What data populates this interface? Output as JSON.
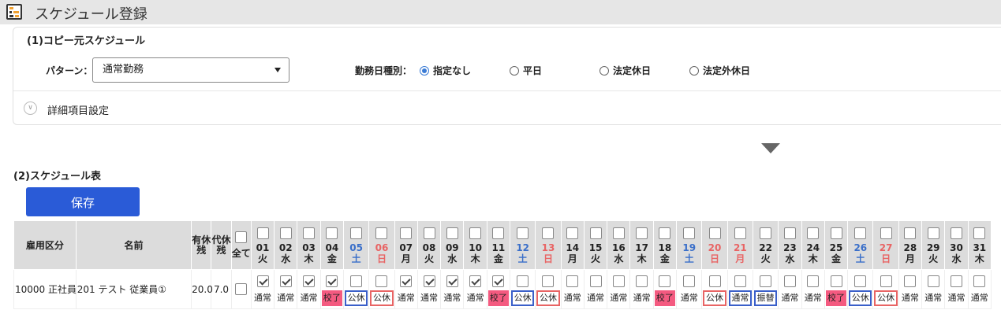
{
  "app": {
    "title": "スケジュール登録",
    "icon": "schedule-list-icon"
  },
  "copy_source": {
    "section_title": "(1)コピー元スケジュール",
    "pattern_label": "パターン：",
    "pattern_value": "通常勤務",
    "workday_label": "勤務日種別：",
    "radios": [
      {
        "label": "指定なし",
        "checked": true
      },
      {
        "label": "平日",
        "checked": false
      },
      {
        "label": "法定休日",
        "checked": false
      },
      {
        "label": "法定外休日",
        "checked": false
      }
    ],
    "detail_label": "詳細項目設定"
  },
  "schedule": {
    "section_title": "(2)スケジュール表",
    "save_label": "保存",
    "headers": {
      "employment": "雇用区分",
      "name": "名前",
      "paid_leave": "有休残",
      "comp_leave": "代休残",
      "all": "全て"
    },
    "days": [
      {
        "num": "01",
        "wd": "火",
        "color": "normal"
      },
      {
        "num": "02",
        "wd": "水",
        "color": "normal"
      },
      {
        "num": "03",
        "wd": "木",
        "color": "normal"
      },
      {
        "num": "04",
        "wd": "金",
        "color": "normal"
      },
      {
        "num": "05",
        "wd": "土",
        "color": "blue"
      },
      {
        "num": "06",
        "wd": "日",
        "color": "red"
      },
      {
        "num": "07",
        "wd": "月",
        "color": "normal"
      },
      {
        "num": "08",
        "wd": "火",
        "color": "normal"
      },
      {
        "num": "09",
        "wd": "水",
        "color": "normal"
      },
      {
        "num": "10",
        "wd": "木",
        "color": "normal"
      },
      {
        "num": "11",
        "wd": "金",
        "color": "normal"
      },
      {
        "num": "12",
        "wd": "土",
        "color": "blue"
      },
      {
        "num": "13",
        "wd": "日",
        "color": "red"
      },
      {
        "num": "14",
        "wd": "月",
        "color": "normal"
      },
      {
        "num": "15",
        "wd": "火",
        "color": "normal"
      },
      {
        "num": "16",
        "wd": "水",
        "color": "normal"
      },
      {
        "num": "17",
        "wd": "木",
        "color": "normal"
      },
      {
        "num": "18",
        "wd": "金",
        "color": "normal"
      },
      {
        "num": "19",
        "wd": "土",
        "color": "blue"
      },
      {
        "num": "20",
        "wd": "日",
        "color": "red"
      },
      {
        "num": "21",
        "wd": "月",
        "color": "red"
      },
      {
        "num": "22",
        "wd": "火",
        "color": "normal"
      },
      {
        "num": "23",
        "wd": "水",
        "color": "normal"
      },
      {
        "num": "24",
        "wd": "木",
        "color": "normal"
      },
      {
        "num": "25",
        "wd": "金",
        "color": "normal"
      },
      {
        "num": "26",
        "wd": "土",
        "color": "blue"
      },
      {
        "num": "27",
        "wd": "日",
        "color": "red"
      },
      {
        "num": "28",
        "wd": "月",
        "color": "normal"
      },
      {
        "num": "29",
        "wd": "火",
        "color": "normal"
      },
      {
        "num": "30",
        "wd": "水",
        "color": "normal"
      },
      {
        "num": "31",
        "wd": "木",
        "color": "normal"
      }
    ],
    "rows": [
      {
        "employment": "10000 正社員",
        "name": "201 テスト 従業員①",
        "paid_leave": "20.0",
        "comp_leave": "7.0",
        "cells": [
          {
            "checked": true,
            "text": "通常",
            "style": "plain"
          },
          {
            "checked": true,
            "text": "通常",
            "style": "plain"
          },
          {
            "checked": true,
            "text": "通常",
            "style": "plain"
          },
          {
            "checked": true,
            "text": "校了",
            "style": "pink"
          },
          {
            "checked": false,
            "text": "公休",
            "style": "bluebox"
          },
          {
            "checked": false,
            "text": "公休",
            "style": "redbox"
          },
          {
            "checked": true,
            "text": "通常",
            "style": "plain"
          },
          {
            "checked": true,
            "text": "通常",
            "style": "plain"
          },
          {
            "checked": true,
            "text": "通常",
            "style": "plain"
          },
          {
            "checked": true,
            "text": "通常",
            "style": "plain"
          },
          {
            "checked": true,
            "text": "校了",
            "style": "pink"
          },
          {
            "checked": false,
            "text": "公休",
            "style": "bluebox"
          },
          {
            "checked": false,
            "text": "公休",
            "style": "redbox"
          },
          {
            "checked": false,
            "text": "通常",
            "style": "plain"
          },
          {
            "checked": false,
            "text": "通常",
            "style": "plain"
          },
          {
            "checked": false,
            "text": "通常",
            "style": "plain"
          },
          {
            "checked": false,
            "text": "通常",
            "style": "plain"
          },
          {
            "checked": false,
            "text": "校了",
            "style": "pink"
          },
          {
            "checked": false,
            "text": "通常",
            "style": "plain"
          },
          {
            "checked": false,
            "text": "公休",
            "style": "redbox"
          },
          {
            "checked": false,
            "text": "通常",
            "style": "bluebox"
          },
          {
            "checked": false,
            "text": "振替",
            "style": "bluebox"
          },
          {
            "checked": false,
            "text": "通常",
            "style": "plain"
          },
          {
            "checked": false,
            "text": "通常",
            "style": "plain"
          },
          {
            "checked": false,
            "text": "校了",
            "style": "pink"
          },
          {
            "checked": false,
            "text": "公休",
            "style": "bluebox"
          },
          {
            "checked": false,
            "text": "公休",
            "style": "redbox"
          },
          {
            "checked": false,
            "text": "通常",
            "style": "plain"
          },
          {
            "checked": false,
            "text": "通常",
            "style": "plain"
          },
          {
            "checked": false,
            "text": "通常",
            "style": "plain"
          },
          {
            "checked": false,
            "text": "通常",
            "style": "plain"
          }
        ]
      }
    ]
  }
}
